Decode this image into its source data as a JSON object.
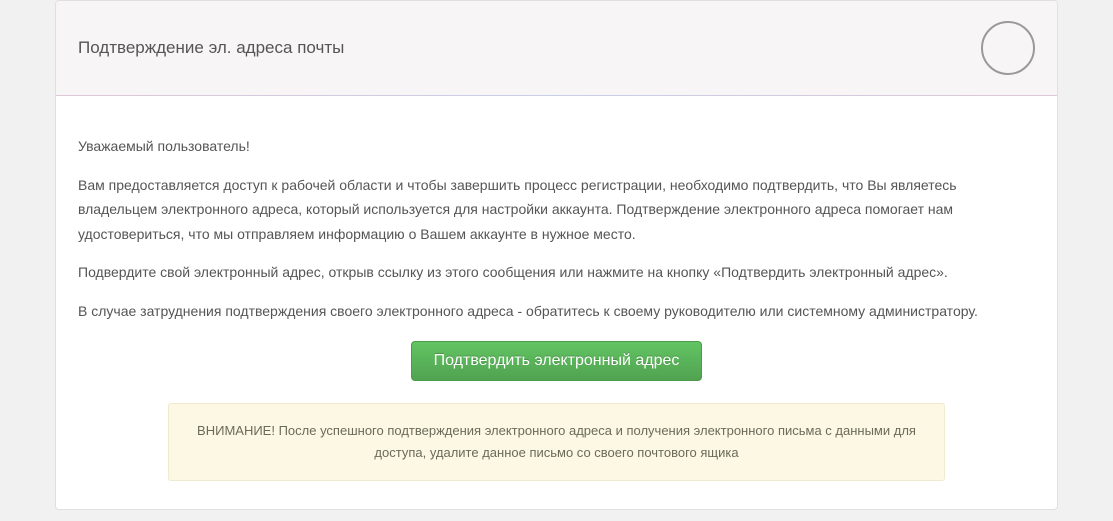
{
  "header": {
    "title": "Подтверждение эл. адреса почты"
  },
  "body": {
    "greeting": "Уважаемый пользователь!",
    "p1": "Вам предоставляется доступ к рабочей области и чтобы завершить процесс регистрации, необходимо подтвердить, что Вы являетесь владельцем электронного адреса, который используется для настройки аккаунта. Подтверждение электронного адреса помогает нам удостовериться, что мы отправляем информацию о Вашем аккаунте в нужное место.",
    "p2": "Подвердите свой электронный адрес, открыв ссылку из этого сообщения или нажмите на кнопку «Подтвердить электронный адрес».",
    "p3": "В случае затруднения подтверждения своего электронного адреса - обратитесь к своему руководителю или системному администратору.",
    "button_label": "Подтвердить электронный адрес"
  },
  "notice": {
    "prefix": "ВНИМАНИЕ!",
    "text": " После успешного подтверждения электронного адреса и получения электронного письма с данными для доступа, удалите данное письмо со своего почтового ящика"
  }
}
